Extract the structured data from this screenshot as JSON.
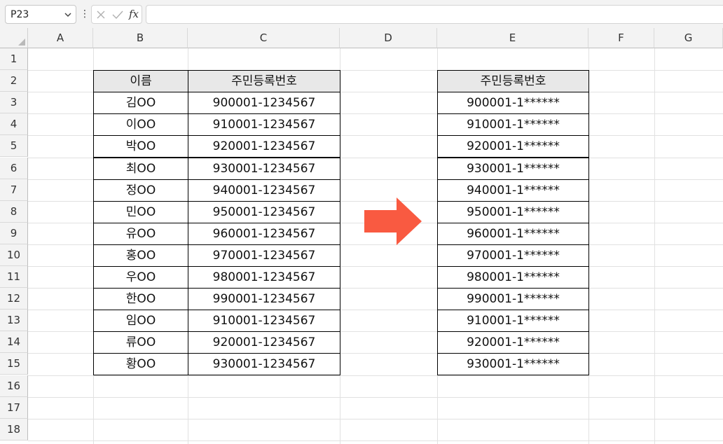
{
  "name_box": {
    "value": "P23"
  },
  "formula_bar": {
    "fx_label": "fx",
    "value": ""
  },
  "columns": [
    "A",
    "B",
    "C",
    "D",
    "E",
    "F",
    "G"
  ],
  "rows": [
    "1",
    "2",
    "3",
    "4",
    "5",
    "6",
    "7",
    "8",
    "9",
    "10",
    "11",
    "12",
    "13",
    "14",
    "15",
    "16",
    "17",
    "18"
  ],
  "left_table": {
    "headers": [
      "이름",
      "주민등록번호"
    ],
    "rows": [
      [
        "김OO",
        "900001-1234567"
      ],
      [
        "이OO",
        "910001-1234567"
      ],
      [
        "박OO",
        "920001-1234567"
      ],
      [
        "최OO",
        "930001-1234567"
      ],
      [
        "정OO",
        "940001-1234567"
      ],
      [
        "민OO",
        "950001-1234567"
      ],
      [
        "유OO",
        "960001-1234567"
      ],
      [
        "홍OO",
        "970001-1234567"
      ],
      [
        "우OO",
        "980001-1234567"
      ],
      [
        "한OO",
        "990001-1234567"
      ],
      [
        "임OO",
        "910001-1234567"
      ],
      [
        "류OO",
        "920001-1234567"
      ],
      [
        "황OO",
        "930001-1234567"
      ]
    ]
  },
  "right_table": {
    "header": "주민등록번호",
    "rows": [
      "900001-1******",
      "910001-1******",
      "920001-1******",
      "930001-1******",
      "940001-1******",
      "950001-1******",
      "960001-1******",
      "970001-1******",
      "980001-1******",
      "990001-1******",
      "910001-1******",
      "920001-1******",
      "930001-1******"
    ]
  },
  "colors": {
    "arrow": "#f95a41",
    "header_fill": "#e8e8e8"
  },
  "icons": {
    "arrow": "right-arrow-shape"
  }
}
